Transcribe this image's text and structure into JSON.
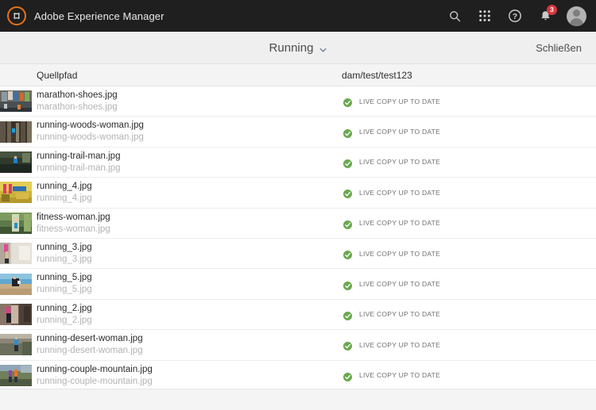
{
  "topbar": {
    "logo_icon": "adobe-experience-cloud-icon",
    "title": "Adobe Experience Manager",
    "background_color": "#1f1f1f",
    "logo_color": "#e8701a",
    "actions": [
      {
        "name": "search-icon",
        "label": "Suche"
      },
      {
        "name": "apps-grid-icon",
        "label": "Lösungen"
      },
      {
        "name": "help-icon",
        "label": "Hilfe"
      },
      {
        "name": "bell-icon",
        "label": "Benachrichtigungen",
        "badge": "3",
        "badge_color": "#d7373f"
      },
      {
        "name": "avatar",
        "label": "Benutzerprofil"
      }
    ]
  },
  "actionbar": {
    "selector_label": "Running",
    "selector_icon": "chevron-down-icon",
    "close_label": "Schließen",
    "background_color": "#efeff0"
  },
  "table": {
    "columns": {
      "source": "Quellpfad",
      "target": "dam/test/test123"
    },
    "status_color": "#6aa84f",
    "rows": [
      {
        "thumb": "marathon-shoes",
        "name": "marathon-shoes.jpg",
        "path": "marathon-shoes.jpg",
        "status": "LIVE COPY UP TO DATE",
        "status_icon": "check-circle-icon"
      },
      {
        "thumb": "running-woods-woman",
        "name": "running-woods-woman.jpg",
        "path": "running-woods-woman.jpg",
        "status": "LIVE COPY UP TO DATE",
        "status_icon": "check-circle-icon"
      },
      {
        "thumb": "running-trail-man",
        "name": "running-trail-man.jpg",
        "path": "running-trail-man.jpg",
        "status": "LIVE COPY UP TO DATE",
        "status_icon": "check-circle-icon"
      },
      {
        "thumb": "running_4",
        "name": "running_4.jpg",
        "path": "running_4.jpg",
        "status": "LIVE COPY UP TO DATE",
        "status_icon": "check-circle-icon"
      },
      {
        "thumb": "fitness-woman",
        "name": "fitness-woman.jpg",
        "path": "fitness-woman.jpg",
        "status": "LIVE COPY UP TO DATE",
        "status_icon": "check-circle-icon"
      },
      {
        "thumb": "running_3",
        "name": "running_3.jpg",
        "path": "running_3.jpg",
        "status": "LIVE COPY UP TO DATE",
        "status_icon": "check-circle-icon"
      },
      {
        "thumb": "running_5",
        "name": "running_5.jpg",
        "path": "running_5.jpg",
        "status": "LIVE COPY UP TO DATE",
        "status_icon": "check-circle-icon"
      },
      {
        "thumb": "running_2",
        "name": "running_2.jpg",
        "path": "running_2.jpg",
        "status": "LIVE COPY UP TO DATE",
        "status_icon": "check-circle-icon"
      },
      {
        "thumb": "running-desert-woman",
        "name": "running-desert-woman.jpg",
        "path": "running-desert-woman.jpg",
        "status": "LIVE COPY UP TO DATE",
        "status_icon": "check-circle-icon"
      },
      {
        "thumb": "running-couple-mountain",
        "name": "running-couple-mountain.jpg",
        "path": "running-couple-mountain.jpg",
        "status": "LIVE COPY UP TO DATE",
        "status_icon": "check-circle-icon"
      }
    ]
  }
}
